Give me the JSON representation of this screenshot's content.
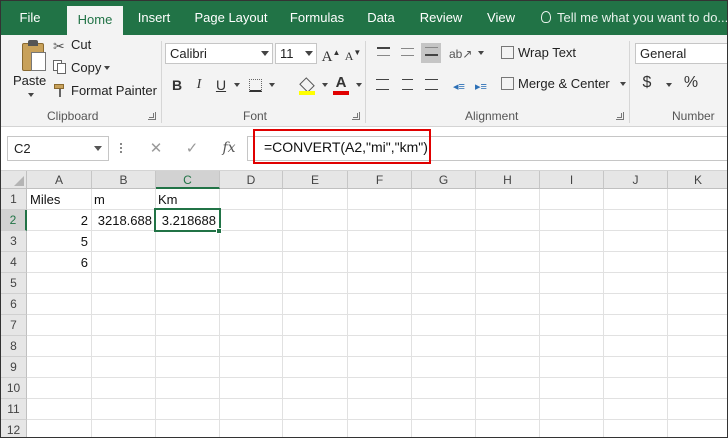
{
  "tabs": [
    {
      "label": "File",
      "active": false
    },
    {
      "label": "Home",
      "active": true
    },
    {
      "label": "Insert",
      "active": false
    },
    {
      "label": "Page Layout",
      "active": false
    },
    {
      "label": "Formulas",
      "active": false
    },
    {
      "label": "Data",
      "active": false
    },
    {
      "label": "Review",
      "active": false
    },
    {
      "label": "View",
      "active": false
    }
  ],
  "tell_me": "Tell me what you want to do...",
  "ribbon": {
    "clipboard": {
      "paste": "Paste",
      "cut": "Cut",
      "copy": "Copy",
      "format_painter": "Format Painter",
      "group_label": "Clipboard"
    },
    "font": {
      "font_name": "Calibri",
      "font_size": "11",
      "bold": "B",
      "italic": "I",
      "underline": "U",
      "grow": "A",
      "shrink": "A",
      "font_color_letter": "A",
      "group_label": "Font"
    },
    "alignment": {
      "wrap_text": "Wrap Text",
      "merge_center": "Merge & Center",
      "group_label": "Alignment"
    },
    "number": {
      "format": "General",
      "currency": "$",
      "percent": "%",
      "group_label": "Number"
    }
  },
  "formula_bar": {
    "name_box": "C2",
    "cancel": "✕",
    "enter": "✓",
    "fx": "fx",
    "formula": "=CONVERT(A2,\"mi\",\"km\")"
  },
  "colors": {
    "accent": "#217346",
    "highlight": "#e00000"
  },
  "grid": {
    "columns": [
      "A",
      "B",
      "C",
      "D",
      "E",
      "F",
      "G",
      "H",
      "I",
      "J",
      "K"
    ],
    "rows": [
      "1",
      "2",
      "3",
      "4",
      "5",
      "6",
      "7",
      "8",
      "9",
      "10",
      "11",
      "12"
    ],
    "selected_column": "C",
    "selected_row": "2",
    "cells": {
      "A1": "Miles",
      "B1": "m",
      "C1": "Km",
      "A2": "2",
      "B2": "3218.688",
      "C2": "3.218688",
      "A3": "5",
      "A4": "6"
    }
  }
}
